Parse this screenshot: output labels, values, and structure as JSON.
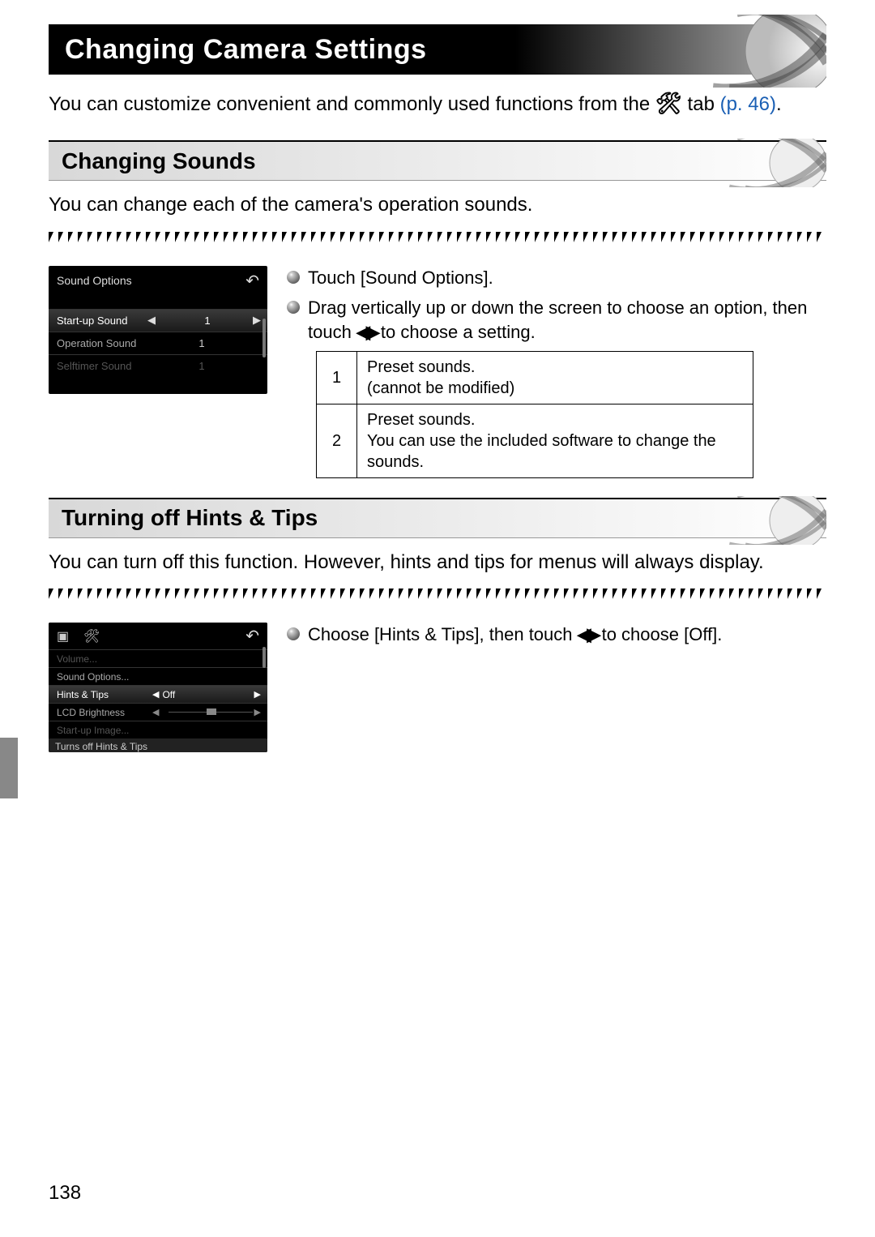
{
  "page": {
    "title": "Changing Camera Settings",
    "intro_part1": "You can customize convenient and commonly used functions from the ",
    "intro_part2": " tab ",
    "intro_link": "(p. 46)",
    "intro_end": ".",
    "number": "138"
  },
  "sounds": {
    "heading": "Changing Sounds",
    "desc": "You can change each of the camera's operation sounds.",
    "bullet1": "Touch [Sound Options].",
    "bullet2a": "Drag vertically up or down the screen to choose an option, then touch ",
    "bullet2b": " to choose a setting.",
    "table": {
      "r1n": "1",
      "r1t": "Preset sounds.\n(cannot be modified)",
      "r2n": "2",
      "r2t": "Preset sounds.\nYou can use the included software to change the sounds."
    },
    "ss": {
      "title": "Sound Options",
      "row1": {
        "label": "Start-up Sound",
        "value": "1"
      },
      "row2": {
        "label": "Operation Sound",
        "value": "1"
      },
      "row3": {
        "label": "Selftimer Sound",
        "value": "1"
      }
    }
  },
  "hints": {
    "heading": "Turning off Hints & Tips",
    "desc": "You can turn off this function. However, hints and tips for menus will always display.",
    "bullet1a": "Choose [Hints & Tips], then touch ",
    "bullet1b": " to choose [Off].",
    "ss": {
      "row0": "Volume...",
      "row1": "Sound Options...",
      "row2": {
        "label": "Hints & Tips",
        "value": "Off"
      },
      "row3": "LCD Brightness",
      "row4": "Start-up Image...",
      "footer": "Turns off Hints & Tips"
    }
  }
}
